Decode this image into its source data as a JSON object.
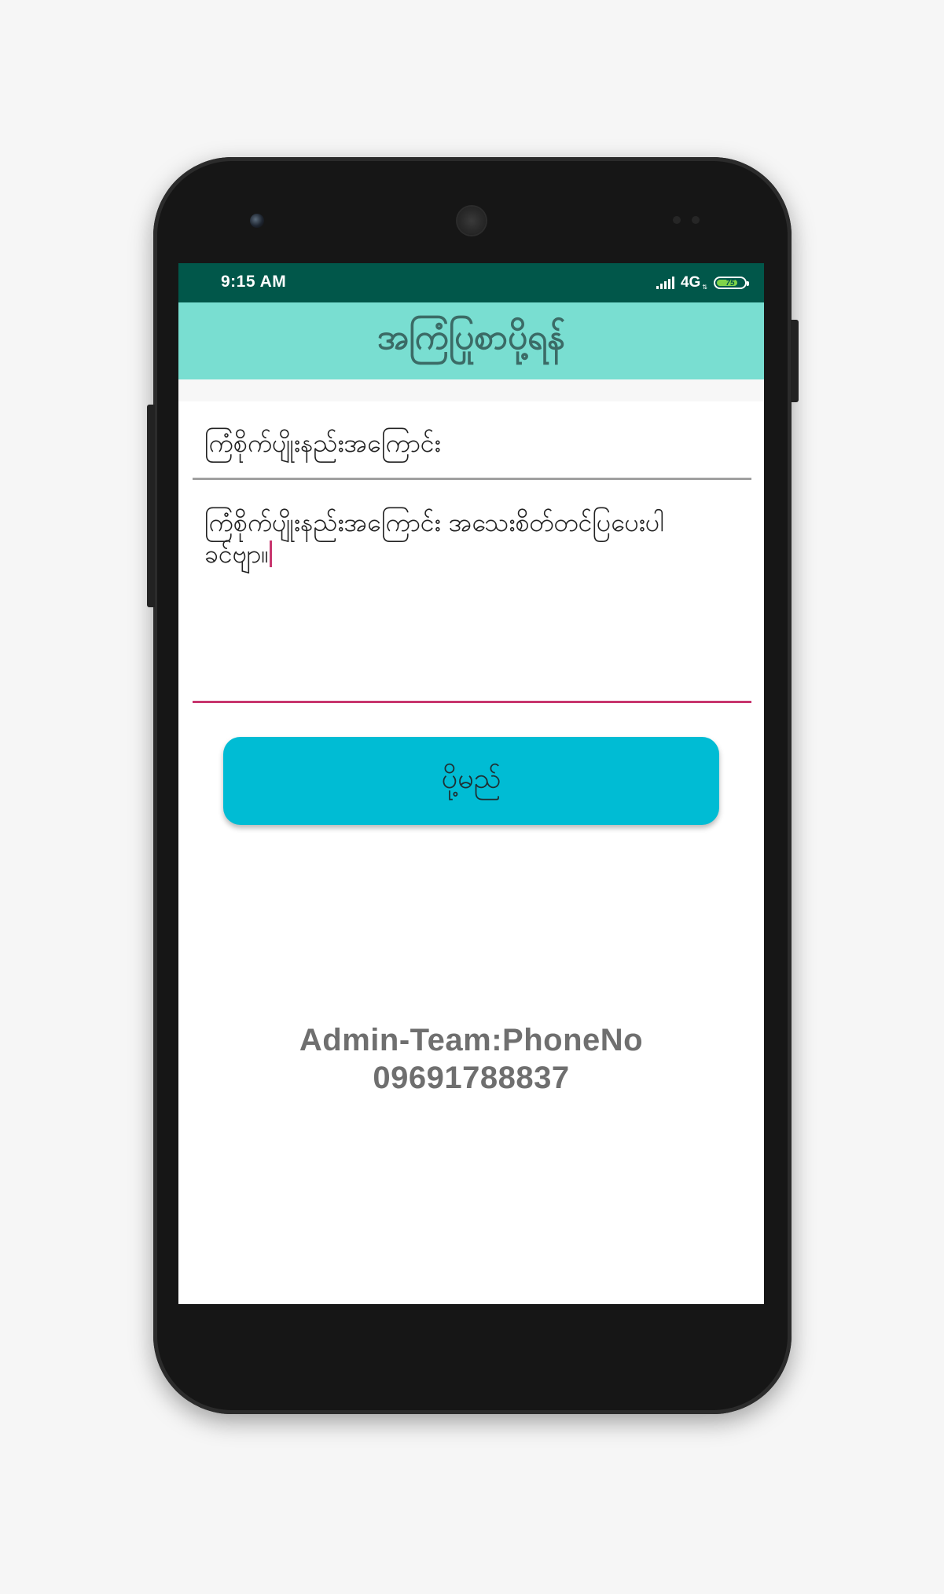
{
  "status_bar": {
    "time": "9:15 AM",
    "network": "4G",
    "battery": "75"
  },
  "app_bar": {
    "title": "အကြံပြုစာပို့ရန်"
  },
  "form": {
    "subject_value": "ကြံစိုက်ပျိုးနည်းအကြောင်း",
    "body_value": "ကြံစိုက်ပျိုးနည်းအကြောင်း အသေးစိတ်တင်ပြပေးပါ ခင်ဗျာ။",
    "send_label": "ပို့မည်"
  },
  "footer": {
    "admin_label": "Admin-Team:PhoneNo",
    "phone_number": "09691788837"
  },
  "colors": {
    "status_bar": "#01574a",
    "app_bar": "#79ded1",
    "button": "#00bcd4",
    "focus_underline": "#c8366e"
  },
  "icons": {
    "signal": "signal-icon",
    "battery": "battery-icon"
  },
  "battery_level": 0.75
}
